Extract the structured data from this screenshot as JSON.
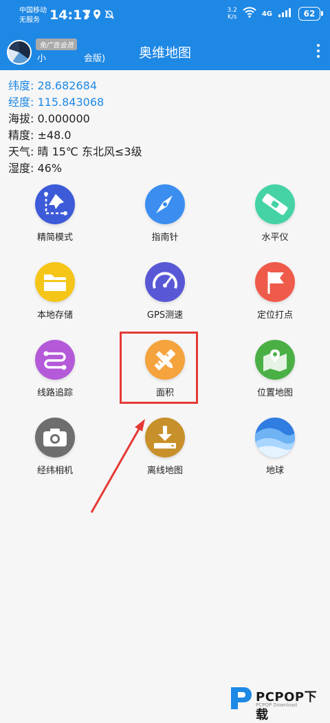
{
  "status": {
    "carrier_line1": "中国移动",
    "carrier_line2": "无服务",
    "time": "14:17",
    "speed_value": "3.2",
    "speed_unit": "K/s",
    "network": "4G",
    "battery": "62"
  },
  "appbar": {
    "vip_badge": "免广告会员",
    "user_fragment1": "小",
    "user_fragment2": "会版)",
    "title": "奥维地图",
    "colors": {
      "primary": "#1e88e5"
    }
  },
  "info": {
    "latitude": "纬度: 28.682684",
    "longitude": "经度: 115.843068",
    "altitude": "海拔: 0.000000",
    "accuracy": "精度: ±48.0",
    "weather": "天气: 晴  15℃  东北风≤3级",
    "humidity": "湿度: 46%"
  },
  "tiles": [
    {
      "label": "精简模式",
      "icon": "map-pin-icon",
      "color": "#3d5bd8"
    },
    {
      "label": "指南针",
      "icon": "compass-icon",
      "color": "#3b8ef0"
    },
    {
      "label": "水平仪",
      "icon": "level-icon",
      "color": "#45d3a6"
    },
    {
      "label": "本地存储",
      "icon": "folder-icon",
      "color": "#f5c518"
    },
    {
      "label": "GPS测速",
      "icon": "speedometer-icon",
      "color": "#5858d6"
    },
    {
      "label": "定位打点",
      "icon": "flag-icon",
      "color": "#ef5b4b"
    },
    {
      "label": "线路追踪",
      "icon": "route-icon",
      "color": "#b45ad8"
    },
    {
      "label": "面积",
      "icon": "ruler-pencil-icon",
      "color": "#f4a33d"
    },
    {
      "label": "位置地图",
      "icon": "location-map-icon",
      "color": "#4ab046"
    },
    {
      "label": "经纬相机",
      "icon": "camera-icon",
      "color": "#6e6e6e"
    },
    {
      "label": "离线地图",
      "icon": "download-icon",
      "color": "#c8902a"
    },
    {
      "label": "地球",
      "icon": "earth-icon",
      "color": "#2f7de1"
    }
  ],
  "watermark": {
    "brand": "PCPOP下载",
    "sub": "PCPOP Download"
  }
}
